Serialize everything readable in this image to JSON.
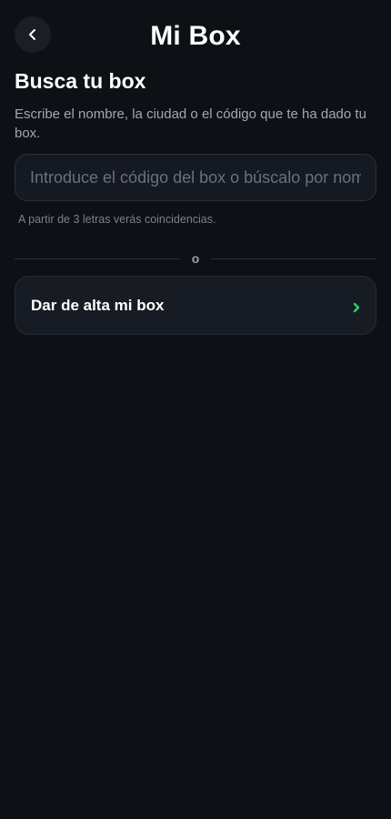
{
  "header": {
    "title": "Mi Box",
    "back_icon": "chevron-left-icon"
  },
  "search": {
    "heading": "Busca tu box",
    "description": "Escribe el nombre, la ciudad o el código que te ha dado tu box.",
    "placeholder": "Introduce el código del box o búscalo por nombre",
    "value": "",
    "hint": "A partir de 3 letras verás coincidencias."
  },
  "divider": {
    "label": "o"
  },
  "register": {
    "label": "Dar de alta mi box",
    "icon": "chevron-right-icon",
    "accent_color": "#2fcf6a"
  },
  "colors": {
    "background": "#0d1015",
    "card": "#171b23",
    "accent": "#2fcf6a"
  }
}
